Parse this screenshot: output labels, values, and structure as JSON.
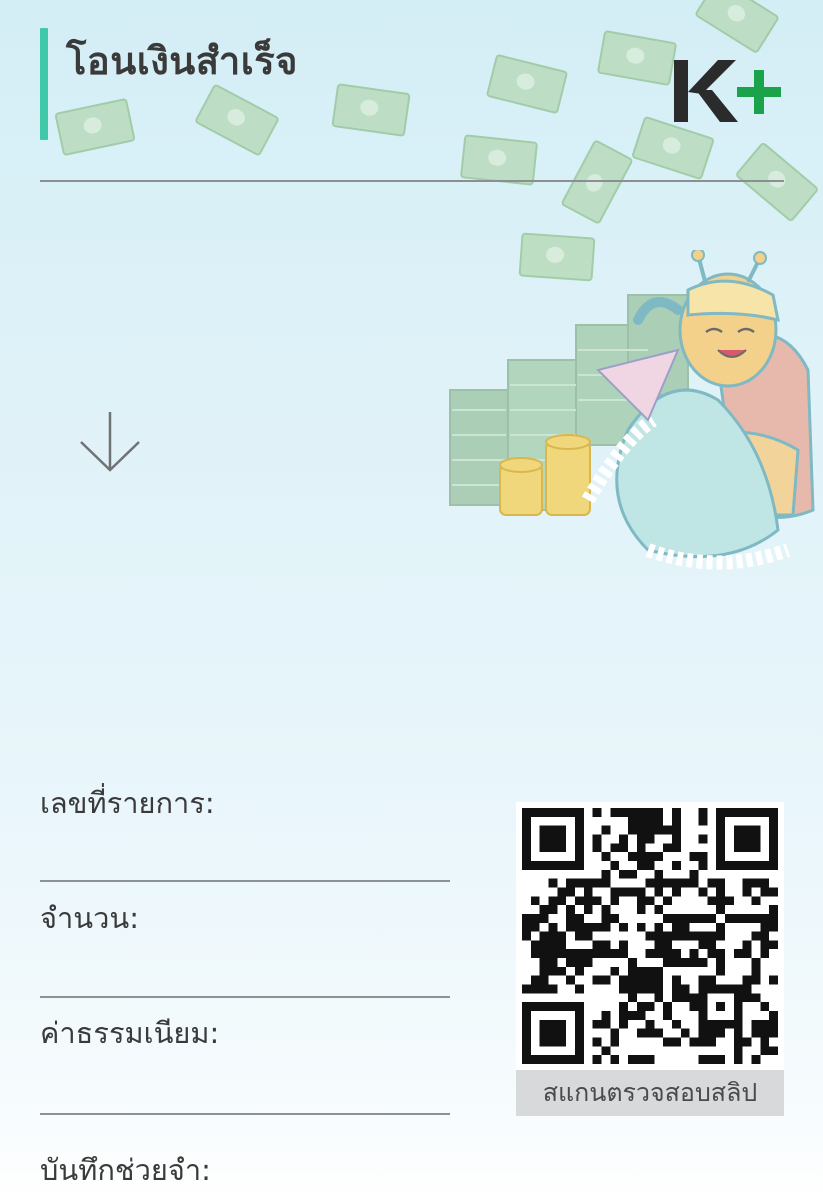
{
  "header": {
    "title": "โอนเงินสำเร็จ",
    "logo_text": "K+",
    "accent_color": "#3fc9a9",
    "logo_dark": "#2b2b2b",
    "logo_green": "#1aa34a"
  },
  "arrow": {
    "icon": "down-arrow-icon"
  },
  "fields": {
    "ref_label": "เลขที่รายการ:",
    "amount_label": "จำนวน:",
    "fee_label": "ค่าธรรมเนียม:",
    "memo_label": "บันทึกช่วยจำ:"
  },
  "qr": {
    "caption": "สแกนตรวจสอบสลิป"
  }
}
